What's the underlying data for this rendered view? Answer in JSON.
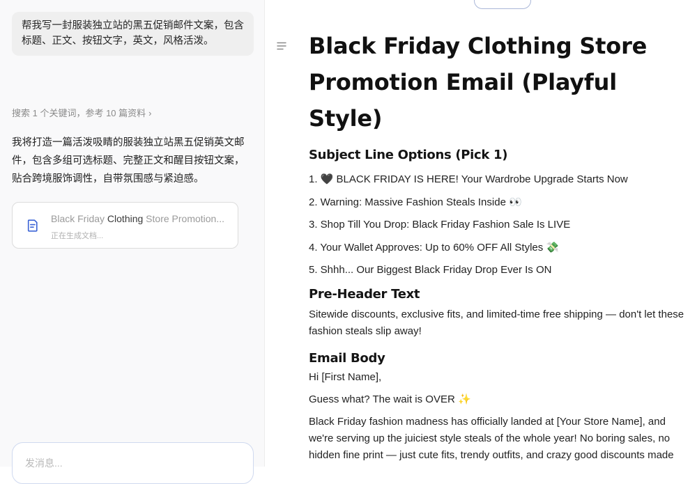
{
  "chat": {
    "user_message": "帮我写一封服装独立站的黑五促销邮件文案，包含标题、正文、按钮文字，英文，风格活泼。",
    "search_meta": "搜索 1 个关键词，参考 10 篇资料",
    "search_meta_chevron": "›",
    "ai_reply": "我将打造一篇活泼吸睛的服装独立站黑五促销英文邮件，包含多组可选标题、完整正文和醒目按钮文案，贴合跨境服饰调性，自带氛围感与紧迫感。",
    "doc_card": {
      "title_prefix": "Black Friday ",
      "title_highlight": "Clothing",
      "title_suffix": " Store Promotion...",
      "status": "正在生成文档..."
    },
    "input_placeholder": "发消息..."
  },
  "document": {
    "title": "Black Friday Clothing Store Promotion Email (Playful Style)",
    "subject_heading": "Subject Line Options (Pick 1)",
    "subject_lines": [
      "1. 🖤 BLACK FRIDAY IS HERE! Your Wardrobe Upgrade Starts Now",
      "2. Warning: Massive Fashion Steals Inside 👀",
      "3. Shop Till You Drop: Black Friday Fashion Sale Is LIVE",
      "4. Your Wallet Approves: Up to 60% OFF All Styles 💸",
      "5. Shhh... Our Biggest Black Friday Drop Ever Is ON"
    ],
    "preheader_heading": "Pre-Header Text",
    "preheader_text": "Sitewide discounts, exclusive fits, and limited-time free shipping — don't let these fashion steals slip away!",
    "body_heading": "Email Body",
    "body_greeting": "Hi [First Name],",
    "body_line1": "Guess what? The wait is OVER ✨",
    "body_para": "Black Friday fashion madness has officially landed at [Your Store Name], and we're serving up the juiciest style steals of the whole year! No boring sales, no hidden fine print — just cute fits, trendy outfits, and crazy good discounts made exactly for your wardrobe."
  },
  "icons": {
    "outline": "outline-menu-icon",
    "document": "document-edit-icon"
  },
  "colors": {
    "accent_border": "#cfd9ef",
    "panel_bg": "#f9f9fa",
    "bubble_bg": "#efefef"
  }
}
